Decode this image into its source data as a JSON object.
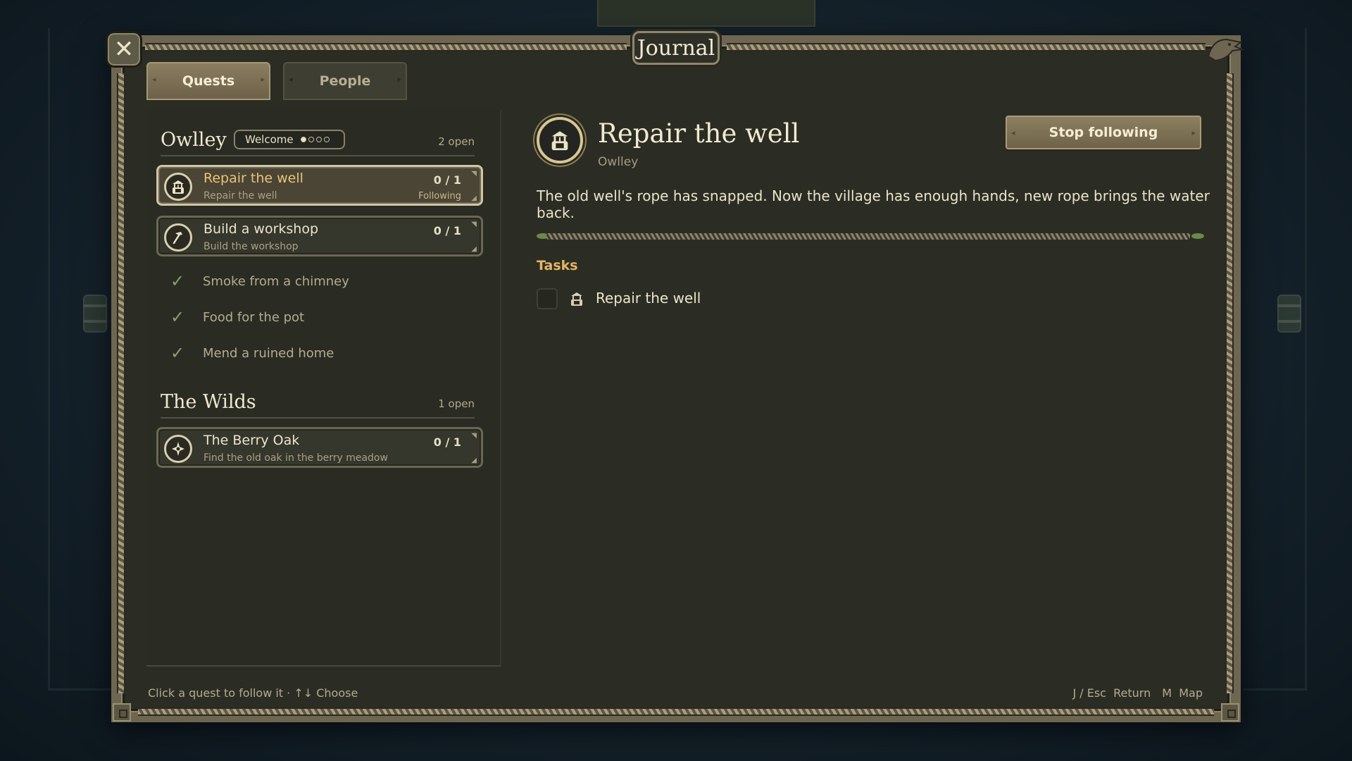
{
  "window": {
    "title": "Journal"
  },
  "tabs": [
    {
      "label": "Quests",
      "active": true
    },
    {
      "label": "People",
      "active": false
    }
  ],
  "groups": [
    {
      "title": "Owlley",
      "badge": "Welcome",
      "badge_progress": {
        "done": 1,
        "total": 4
      },
      "count": "2 open",
      "quests": [
        {
          "title": "Repair the well",
          "subtitle": "Repair the well",
          "progress": "0 / 1",
          "status": "Following",
          "icon": "well-icon",
          "selected": true
        },
        {
          "title": "Build a workshop",
          "subtitle": "Build the workshop",
          "progress": "0 / 1",
          "status": "",
          "icon": "hammer-icon",
          "selected": false
        }
      ],
      "completed": [
        "Smoke from a chimney",
        "Food for the pot",
        "Mend a ruined home"
      ]
    },
    {
      "title": "The Wilds",
      "count": "1 open",
      "quests": [
        {
          "title": "The Berry Oak",
          "subtitle": "Find the old oak in the berry meadow",
          "progress": "0 / 1",
          "status": "",
          "icon": "oak-icon",
          "selected": false
        }
      ]
    }
  ],
  "detail": {
    "title": "Repair the well",
    "region": "Owlley",
    "icon": "well-icon",
    "stop_button": "Stop following",
    "description": "The old well's rope has snapped. Now the village has enough hands, new rope brings the water back.",
    "tasks_label": "Tasks",
    "tasks": [
      {
        "label": "Repair the well",
        "done": false,
        "icon": "well-icon"
      }
    ]
  },
  "footer": {
    "hint": "Click a quest to follow it · ↑↓ Choose",
    "return": "J / Esc  Return",
    "map": "M  Map"
  },
  "colors": {
    "accent_gold": "#ecc279",
    "tasks_orange": "#e5b466",
    "check_green": "#8aa06a",
    "panel": "#2b2d24"
  }
}
